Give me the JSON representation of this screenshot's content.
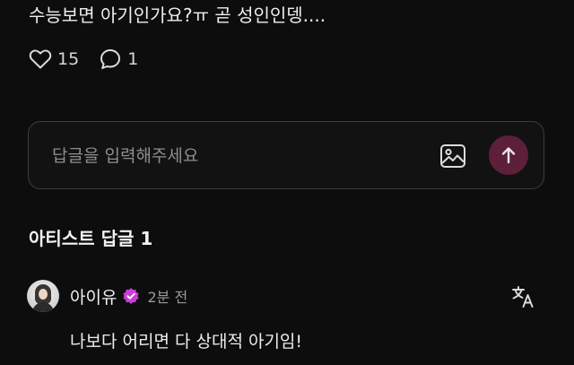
{
  "post": {
    "text": "수능보면 아기인가요?ㅠ 곧 성인인뎅....",
    "likes": "15",
    "comments": "1"
  },
  "reply": {
    "placeholder": "답글을 입력해주세요"
  },
  "section": {
    "title": "아티스트 답글 1"
  },
  "comment": {
    "author": "아이유",
    "time": "2분 전",
    "text": "나보다 어리면 다 상대적 아기임!"
  },
  "icons": {
    "like": "heart-icon",
    "comment": "speech-bubble-icon",
    "image": "image-icon",
    "send": "arrow-up-icon",
    "verified": "verified-badge-icon",
    "translate": "translate-icon"
  },
  "colors": {
    "background": "#0d0d0d",
    "send_button": "#5e1f3b",
    "verified_badge": "#c63fd6"
  }
}
